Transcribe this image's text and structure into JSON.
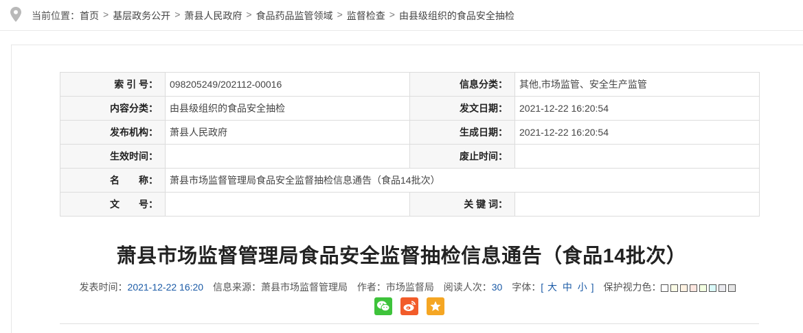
{
  "breadcrumb": {
    "prefix": "当前位置：",
    "items": [
      "首页",
      "基层政务公开",
      "萧县人民政府",
      "食品药品监管领域",
      "监督检查",
      "由县级组织的食品安全抽检"
    ],
    "separator": ">"
  },
  "meta": {
    "index_label": "索 引 号：",
    "index_value": "098205249/202112-00016",
    "info_category_label": "信息分类：",
    "info_category_value": "其他,市场监管、安全生产监管",
    "content_category_label": "内容分类：",
    "content_category_value": "由县级组织的食品安全抽检",
    "issue_date_label": "发文日期：",
    "issue_date_value": "2021-12-22 16:20:54",
    "publisher_label": "发布机构：",
    "publisher_value": "萧县人民政府",
    "generate_date_label": "生成日期：",
    "generate_date_value": "2021-12-22 16:20:54",
    "effective_label": "生效时间：",
    "effective_value": "",
    "abolish_label": "废止时间：",
    "abolish_value": "",
    "name_label": "名　　称：",
    "name_value": "萧县市场监督管理局食品安全监督抽检信息通告（食品14批次）",
    "doc_no_label": "文　　号：",
    "doc_no_value": "",
    "keywords_label": "关 键 词：",
    "keywords_value": ""
  },
  "article": {
    "title": "萧县市场监督管理局食品安全监督抽检信息通告（食品14批次）",
    "publish_time_label": "发表时间：",
    "publish_time": "2021-12-22 16:20",
    "source_label": "信息来源：",
    "source": "萧县市场监督管理局",
    "author_label": "作者：",
    "author": "市场监督局",
    "views_label": "阅读人次：",
    "views": "30",
    "font_label": "字体：",
    "font_open": "[",
    "font_large": "大",
    "font_medium": "中",
    "font_small": "小",
    "font_close": "]",
    "eye_label": "保护视力色："
  },
  "swatches": [
    "#ffffff",
    "#fafbe6",
    "#fff2e2",
    "#fde6e0",
    "#f3ffe1",
    "#dafaf9",
    "#eaeaef",
    "#e6e6e6"
  ],
  "icons": [
    "map-pin-icon",
    "wechat-icon",
    "weibo-icon",
    "star-icon"
  ]
}
